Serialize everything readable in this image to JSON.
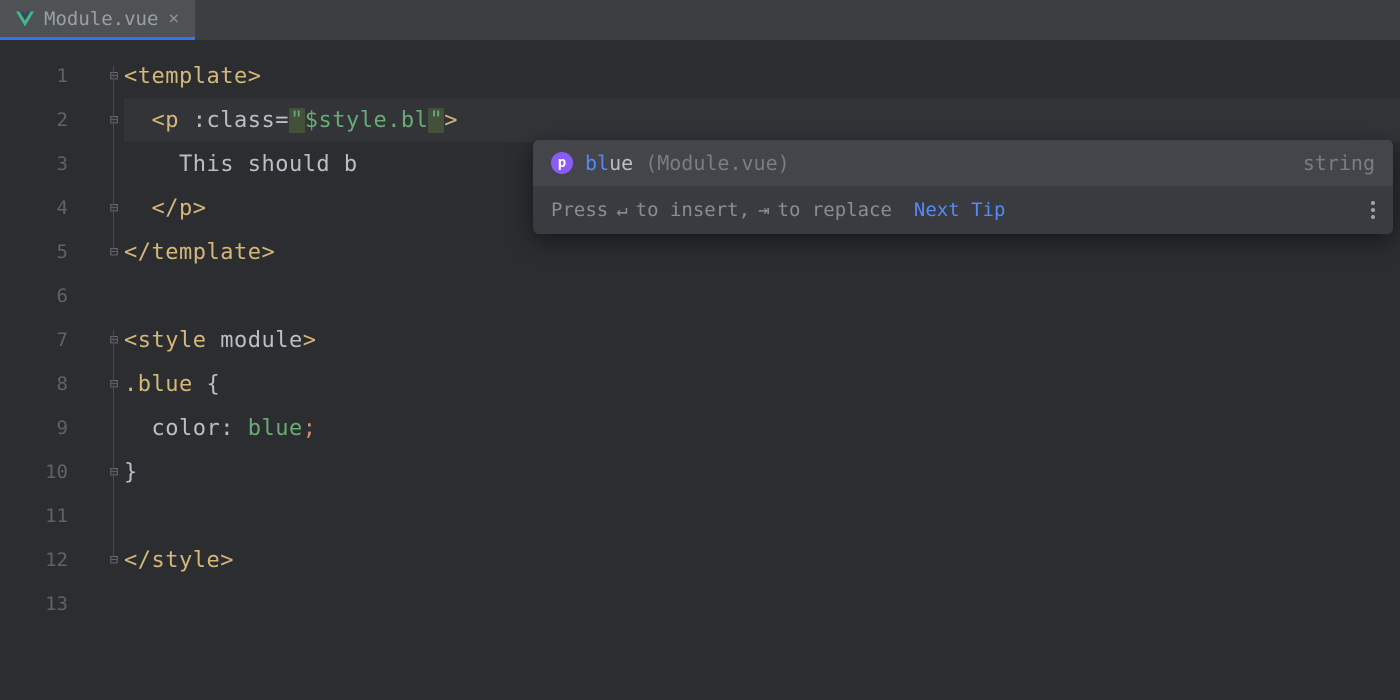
{
  "tab": {
    "filename": "Module.vue"
  },
  "gutter": [
    "1",
    "2",
    "3",
    "4",
    "5",
    "6",
    "7",
    "8",
    "9",
    "10",
    "11",
    "12",
    "13"
  ],
  "code": {
    "l1": {
      "open": "<",
      "tag": "template",
      "close": ">"
    },
    "l2": {
      "indent": "  ",
      "open": "<",
      "tag": "p",
      "sp": " ",
      "attr": ":class=",
      "q": "\"",
      "val": "$style.bl",
      "close": ">"
    },
    "l3": {
      "indent": "    ",
      "text": "This should b"
    },
    "l4": {
      "indent": "  ",
      "open": "</",
      "tag": "p",
      "close": ">"
    },
    "l5": {
      "open": "</",
      "tag": "template",
      "close": ">"
    },
    "l7": {
      "open": "<",
      "tag": "style",
      "sp": " ",
      "attr": "module",
      "close": ">"
    },
    "l8": {
      "sel": ".blue",
      "sp": " ",
      "brace": "{"
    },
    "l9": {
      "indent": "  ",
      "prop": "color",
      "colon": ": ",
      "val": "blue",
      "semi": ";"
    },
    "l10": {
      "brace": "}"
    },
    "l12": {
      "open": "</",
      "tag": "style",
      "close": ">"
    }
  },
  "popup": {
    "icon_letter": "p",
    "match_prefix": "bl",
    "match_suffix": "ue",
    "origin": "(Module.vue)",
    "type": "string",
    "hint_pre": "Press ",
    "hint_key1": "↵",
    "hint_mid": " to insert, ",
    "hint_key2": "⇥",
    "hint_post": " to replace",
    "next_tip": "Next Tip"
  },
  "colors": {
    "swatch": "#0000ff"
  }
}
